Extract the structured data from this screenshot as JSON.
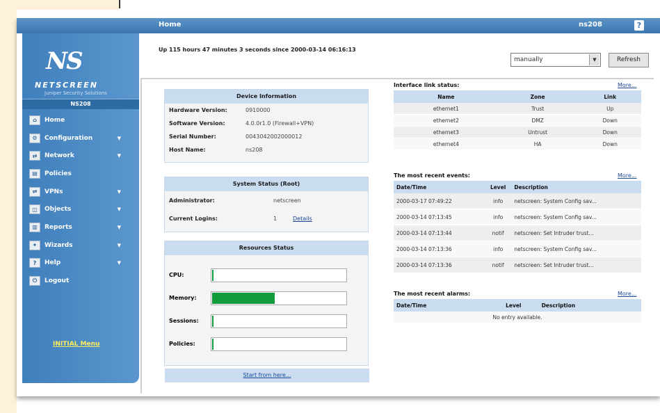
{
  "header": {
    "title": "Home",
    "hostname": "ns208",
    "help_label": "?"
  },
  "sidebar": {
    "logo_text": "NS",
    "brand": "NETSCREEN",
    "brand_sub": "Juniper Security Solutions",
    "model": "NS208",
    "items": [
      {
        "label": "Home",
        "icon": "home-icon",
        "submenu": false
      },
      {
        "label": "Configuration",
        "icon": "config-icon",
        "submenu": true
      },
      {
        "label": "Network",
        "icon": "network-icon",
        "submenu": true
      },
      {
        "label": "Policies",
        "icon": "policies-icon",
        "submenu": false
      },
      {
        "label": "VPNs",
        "icon": "vpn-icon",
        "submenu": true
      },
      {
        "label": "Objects",
        "icon": "objects-icon",
        "submenu": true
      },
      {
        "label": "Reports",
        "icon": "reports-icon",
        "submenu": true
      },
      {
        "label": "Wizards",
        "icon": "wizards-icon",
        "submenu": true
      },
      {
        "label": "Help",
        "icon": "help-icon",
        "submenu": true
      },
      {
        "label": "Logout",
        "icon": "logout-icon",
        "submenu": false
      }
    ],
    "initial_link": "INITIAL Menu"
  },
  "uptime": "Up 115 hours 47 minutes 3 seconds since 2000-03-14 06:16:13",
  "refresh": {
    "selected": "manually",
    "button": "Refresh"
  },
  "device_info": {
    "title": "Device Information",
    "rows": [
      {
        "k": "Hardware Version:",
        "v": "0910000"
      },
      {
        "k": "Software Version:",
        "v": "4.0.0r1.0 (Firewall+VPN)"
      },
      {
        "k": "Serial Number:",
        "v": "0043042002000012"
      },
      {
        "k": "Host Name:",
        "v": "ns208"
      }
    ]
  },
  "system_status": {
    "title": "System Status (Root)",
    "admin_label": "Administrator:",
    "admin_value": "netscreen",
    "logins_label": "Current Logins:",
    "logins_value": "1",
    "details_link": "Details"
  },
  "resources": {
    "title": "Resources Status",
    "rows": [
      {
        "label": "CPU:",
        "level": 0.01
      },
      {
        "label": "Memory:",
        "level": 0.47
      },
      {
        "label": "Sessions:",
        "level": 0.01
      },
      {
        "label": "Policies:",
        "level": 0.01
      }
    ],
    "color": "#109c3d"
  },
  "start_link": "Start from here...",
  "interface_status": {
    "title": "Interface link status:",
    "more": "More...",
    "headers": [
      "Name",
      "Zone",
      "Link"
    ],
    "rows": [
      [
        "ethernet1",
        "Trust",
        "Up"
      ],
      [
        "ethernet2",
        "DMZ",
        "Down"
      ],
      [
        "ethernet3",
        "Untrust",
        "Down"
      ],
      [
        "ethernet4",
        "HA",
        "Down"
      ]
    ]
  },
  "events": {
    "title": "The most recent events:",
    "more": "More...",
    "headers": [
      "Date/Time",
      "Level",
      "Description"
    ],
    "rows": [
      [
        "2000-03-17 07:49:22",
        "info",
        "netscreen: System Config sav..."
      ],
      [
        "2000-03-14 07:13:45",
        "info",
        "netscreen: System Config sav..."
      ],
      [
        "2000-03-14 07:13:44",
        "notif",
        "netscreen: Set Intruder trust..."
      ],
      [
        "2000-03-14 07:13:36",
        "info",
        "netscreen: System Config sav..."
      ],
      [
        "2000-03-14 07:13:36",
        "notif",
        "netscreen: Set Intruder trust..."
      ]
    ]
  },
  "alarms": {
    "title": "The most recent alarms:",
    "more": "More...",
    "headers": [
      "Date/Time",
      "Level",
      "Description"
    ],
    "empty": "No entry available."
  }
}
